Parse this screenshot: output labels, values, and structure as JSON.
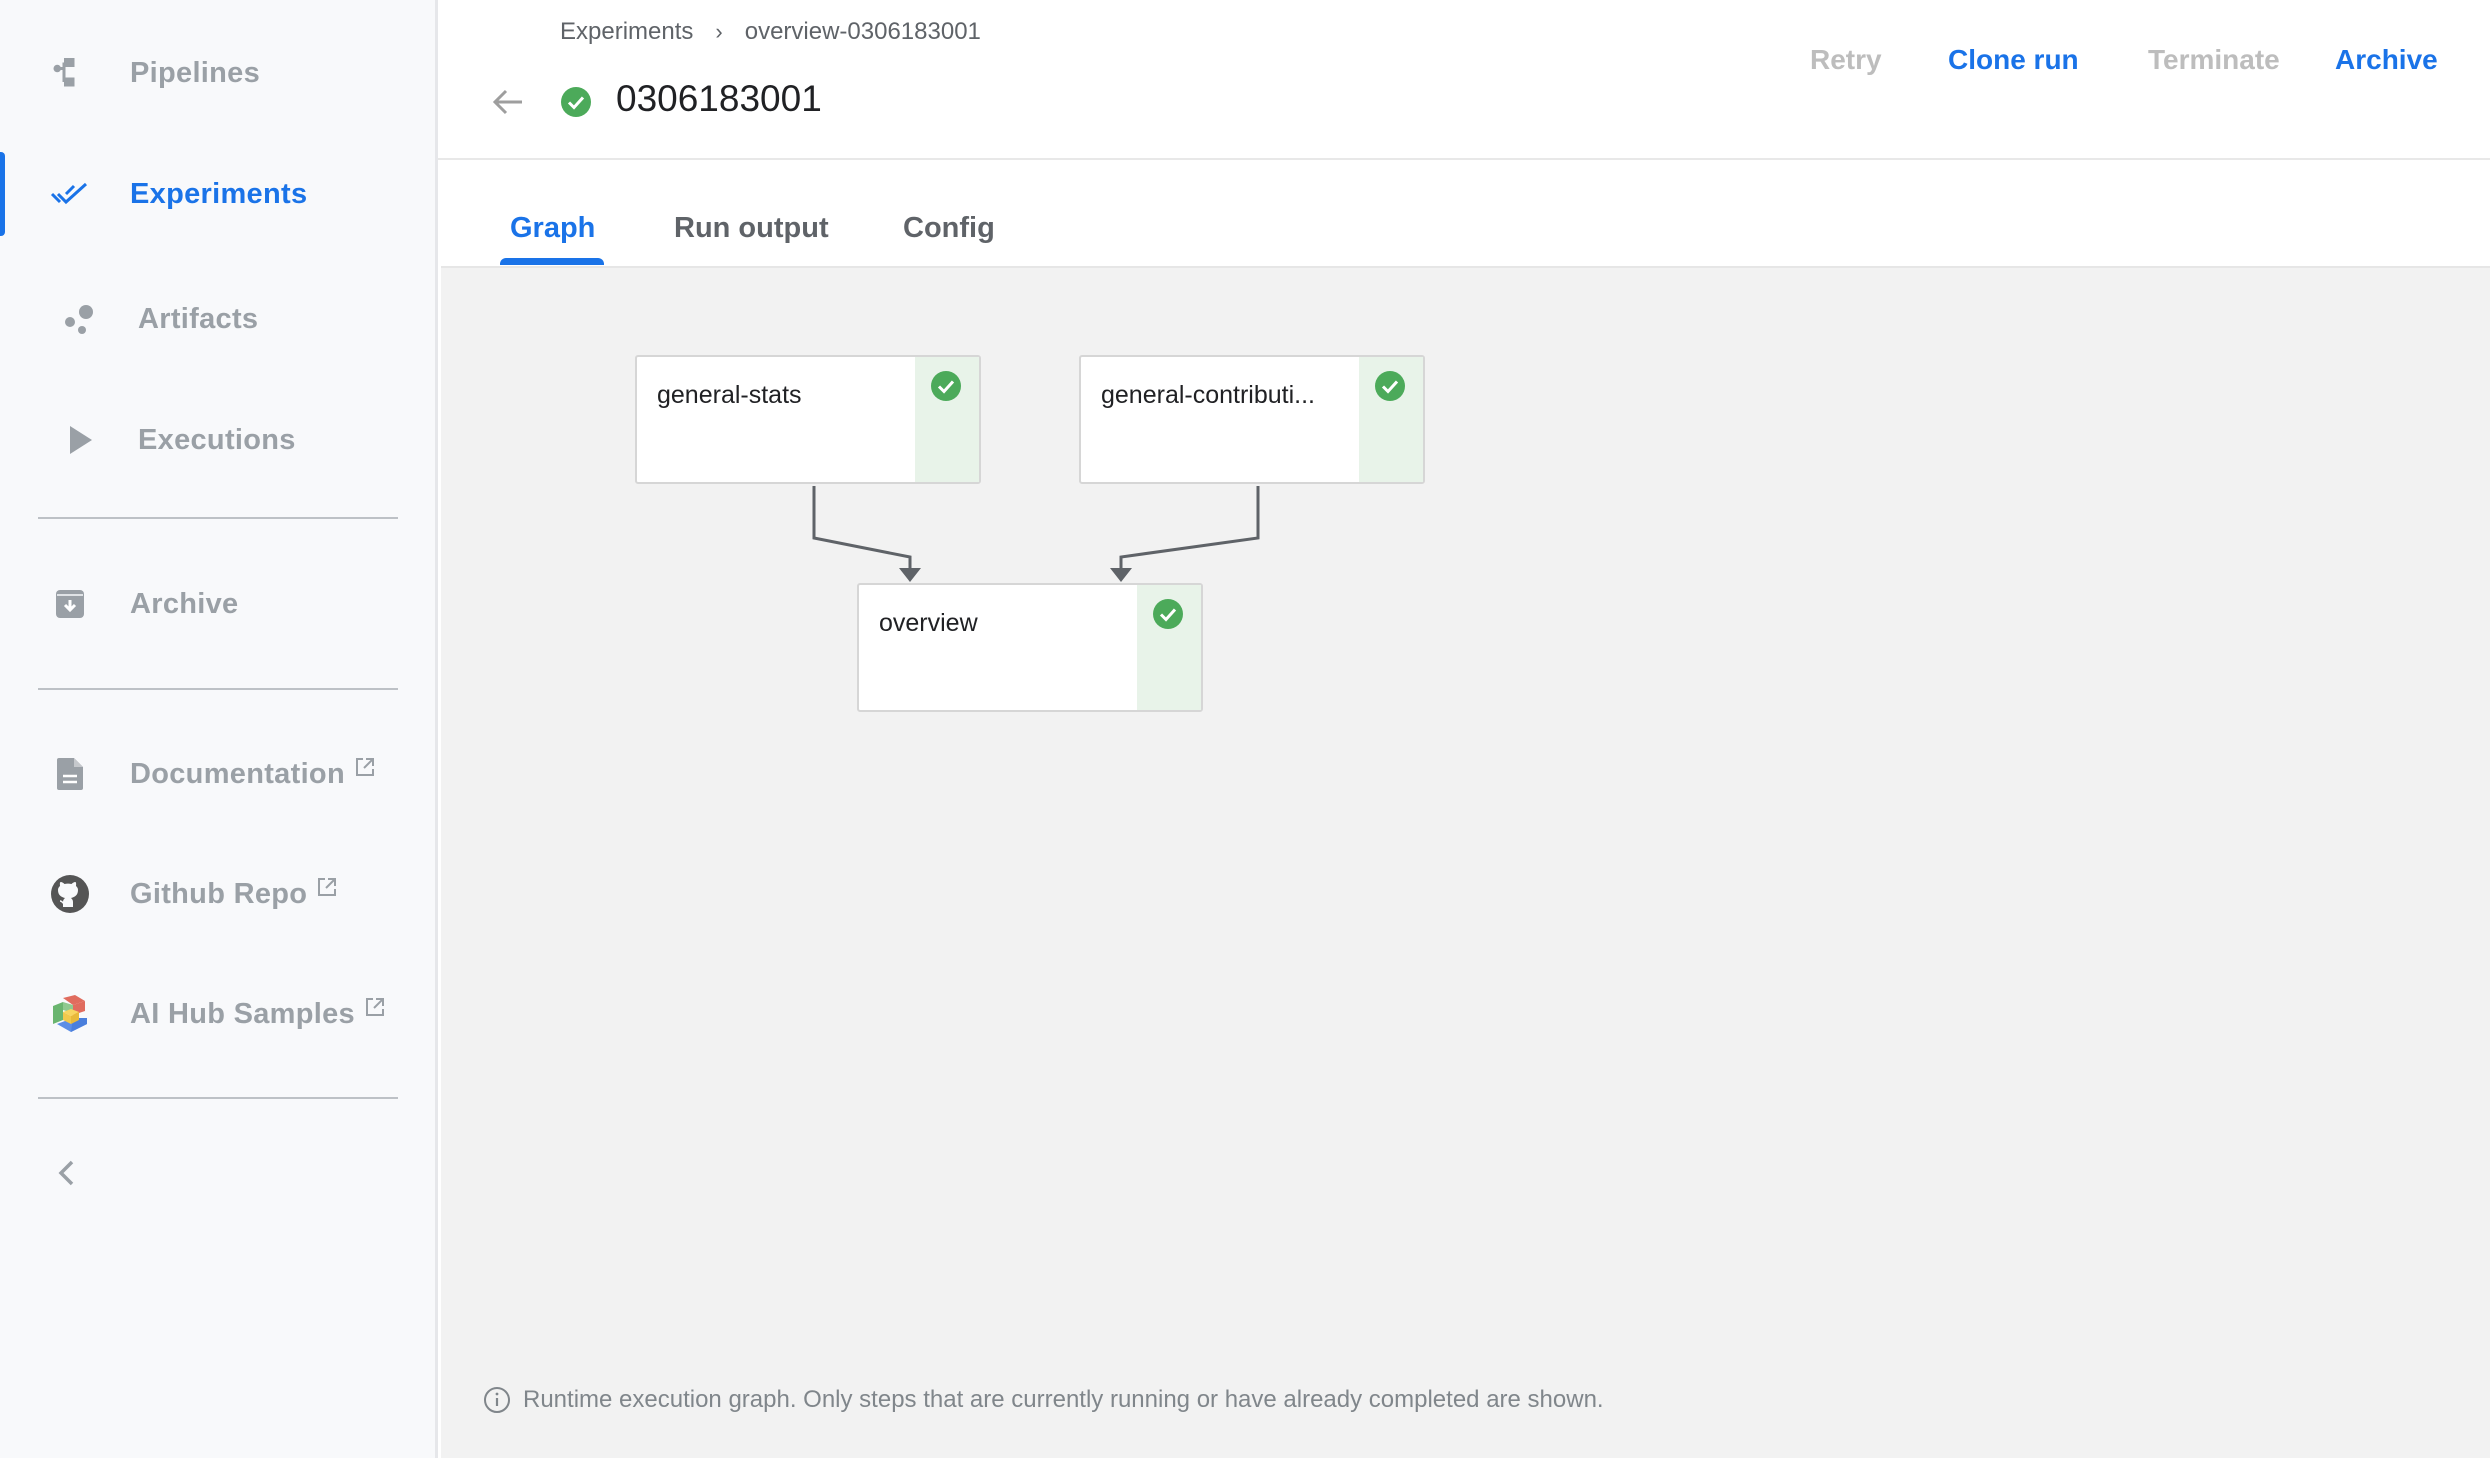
{
  "sidebar": {
    "items": [
      {
        "label": "Pipelines",
        "icon": "pipelines-icon",
        "active": false
      },
      {
        "label": "Experiments",
        "icon": "experiments-double-check-icon",
        "active": true
      },
      {
        "label": "Artifacts",
        "icon": "artifacts-bubbles-icon",
        "active": false
      },
      {
        "label": "Executions",
        "icon": "play-icon",
        "active": false
      },
      {
        "label": "Archive",
        "icon": "archive-icon",
        "active": false
      }
    ],
    "links": [
      {
        "label": "Documentation",
        "icon": "document-icon",
        "external": true
      },
      {
        "label": "Github Repo",
        "icon": "github-icon",
        "external": true
      },
      {
        "label": "AI Hub Samples",
        "icon": "ai-hub-icon",
        "external": true
      }
    ],
    "collapse_icon": "chevron-left-icon"
  },
  "header": {
    "breadcrumb": [
      "Experiments",
      "overview-0306183001"
    ],
    "breadcrumb_separator": "›",
    "title": "0306183001",
    "status": "succeeded",
    "actions": [
      {
        "label": "Retry",
        "enabled": false
      },
      {
        "label": "Clone run",
        "enabled": true
      },
      {
        "label": "Terminate",
        "enabled": false
      },
      {
        "label": "Archive",
        "enabled": true
      }
    ]
  },
  "tabs": [
    {
      "label": "Graph",
      "active": true
    },
    {
      "label": "Run output",
      "active": false
    },
    {
      "label": "Config",
      "active": false
    }
  ],
  "graph": {
    "nodes": [
      {
        "id": "general-stats",
        "label": "general-stats",
        "status": "succeeded"
      },
      {
        "id": "general-contribution",
        "label": "general-contributi...",
        "status": "succeeded"
      },
      {
        "id": "overview",
        "label": "overview",
        "status": "succeeded"
      }
    ],
    "edges": [
      {
        "from": "general-stats",
        "to": "overview"
      },
      {
        "from": "general-contribution",
        "to": "overview"
      }
    ],
    "info_text": "Runtime execution graph. Only steps that are currently running or have already completed are shown."
  },
  "colors": {
    "accent": "#1a73e8",
    "success": "#34a853",
    "success_bg": "#e8f3e9",
    "muted": "#9aa0a6"
  }
}
